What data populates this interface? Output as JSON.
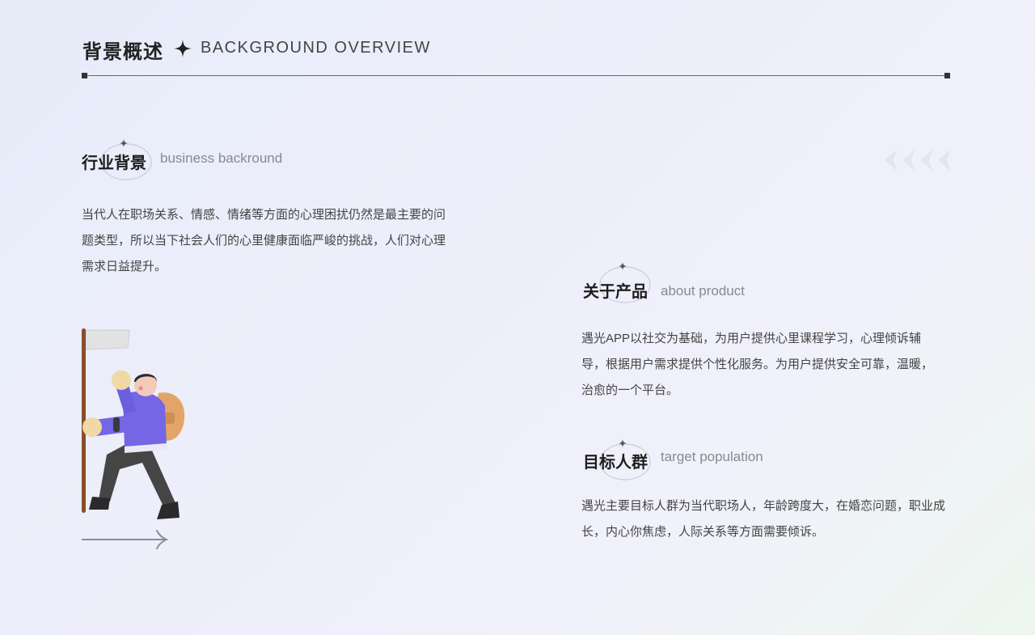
{
  "header": {
    "title": "背景概述",
    "subtitle": "BACKGROUND OVERVIEW"
  },
  "sections": {
    "industry": {
      "title": "行业背景",
      "subtitle": "business backround",
      "body": "当代人在职场关系、情感、情绪等方面的心理困扰仍然是最主要的问题类型，所以当下社会人们的心里健康面临严峻的挑战，人们对心理需求日益提升。"
    },
    "product": {
      "title": "关于产品",
      "subtitle": "about product",
      "body": "遇光APP以社交为基础，为用户提供心里课程学习，心理倾诉辅导，根据用户需求提供个性化服务。为用户提供安全可靠，温暖，治愈的一个平台。"
    },
    "audience": {
      "title": "目标人群",
      "subtitle": "target population",
      "body": "遇光主要目标人群为当代职场人，年龄跨度大，在婚恋问题，职业成长，内心你焦虑，人际关系等方面需要倾诉。"
    }
  },
  "icons": {
    "title_star": "four-point-star-icon",
    "section_star": "small-star-icon",
    "chevrons": "left-chevrons-icon",
    "arrow": "right-arrow-icon",
    "illustration": "hiker-with-flag-illustration"
  },
  "colors": {
    "accent_purple": "#6b5fe0",
    "ring": "#c9ccd8",
    "text": "#444444"
  }
}
